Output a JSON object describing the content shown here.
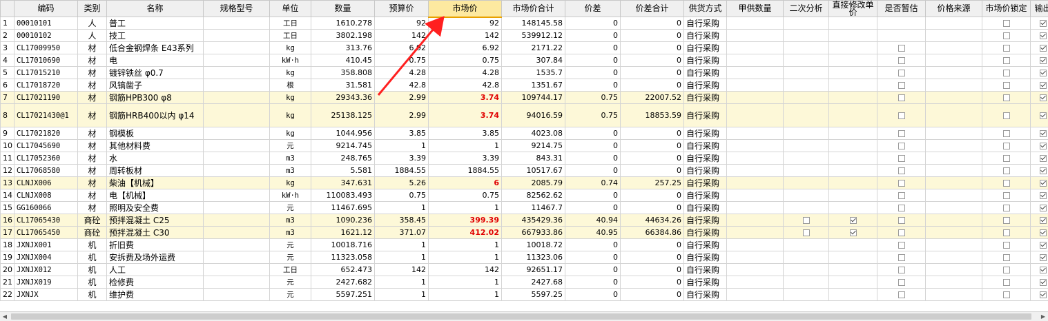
{
  "headers": [
    "编码",
    "类别",
    "名称",
    "规格型号",
    "单位",
    "数量",
    "预算价",
    "市场价",
    "市场价合计",
    "价差",
    "价差合计",
    "供货方式",
    "甲供数量",
    "二次分析",
    "直接修改单价",
    "是否暂估",
    "价格来源",
    "市场价锁定",
    "输出"
  ],
  "rows": [
    {
      "idx": "1",
      "code": "00010101",
      "cat": "人",
      "name": "普工",
      "spec": "",
      "unit": "工日",
      "qty": "1610.278",
      "budget": "92",
      "market": "92",
      "market_total": "148145.58",
      "diff": "0",
      "diff_total": "0",
      "supply": "自行采购",
      "jia_qty": "",
      "second": null,
      "direct": null,
      "est": null,
      "source": "",
      "lock": false,
      "output": true,
      "hl": false,
      "red": false,
      "tall": false
    },
    {
      "idx": "2",
      "code": "00010102",
      "cat": "人",
      "name": "技工",
      "spec": "",
      "unit": "工日",
      "qty": "3802.198",
      "budget": "142",
      "market": "142",
      "market_total": "539912.12",
      "diff": "0",
      "diff_total": "0",
      "supply": "自行采购",
      "jia_qty": "",
      "second": null,
      "direct": null,
      "est": null,
      "source": "",
      "lock": false,
      "output": true,
      "hl": false,
      "red": false,
      "tall": false
    },
    {
      "idx": "3",
      "code": "CL17009950",
      "cat": "材",
      "name": "低合金钢焊条 E43系列",
      "spec": "",
      "unit": "kg",
      "qty": "313.76",
      "budget": "6.92",
      "market": "6.92",
      "market_total": "2171.22",
      "diff": "0",
      "diff_total": "0",
      "supply": "自行采购",
      "jia_qty": "",
      "second": null,
      "direct": null,
      "est": false,
      "source": "",
      "lock": false,
      "output": true,
      "hl": false,
      "red": false,
      "tall": false
    },
    {
      "idx": "4",
      "code": "CL17010690",
      "cat": "材",
      "name": "电",
      "spec": "",
      "unit": "kW·h",
      "qty": "410.45",
      "budget": "0.75",
      "market": "0.75",
      "market_total": "307.84",
      "diff": "0",
      "diff_total": "0",
      "supply": "自行采购",
      "jia_qty": "",
      "second": null,
      "direct": null,
      "est": false,
      "source": "",
      "lock": false,
      "output": true,
      "hl": false,
      "red": false,
      "tall": false
    },
    {
      "idx": "5",
      "code": "CL17015210",
      "cat": "材",
      "name": "镀锌铁丝 φ0.7",
      "spec": "",
      "unit": "kg",
      "qty": "358.808",
      "budget": "4.28",
      "market": "4.28",
      "market_total": "1535.7",
      "diff": "0",
      "diff_total": "0",
      "supply": "自行采购",
      "jia_qty": "",
      "second": null,
      "direct": null,
      "est": false,
      "source": "",
      "lock": false,
      "output": true,
      "hl": false,
      "red": false,
      "tall": false
    },
    {
      "idx": "6",
      "code": "CL17018720",
      "cat": "材",
      "name": "风镐凿子",
      "spec": "",
      "unit": "根",
      "qty": "31.581",
      "budget": "42.8",
      "market": "42.8",
      "market_total": "1351.67",
      "diff": "0",
      "diff_total": "0",
      "supply": "自行采购",
      "jia_qty": "",
      "second": null,
      "direct": null,
      "est": false,
      "source": "",
      "lock": false,
      "output": true,
      "hl": false,
      "red": false,
      "tall": false
    },
    {
      "idx": "7",
      "code": "CL17021190",
      "cat": "材",
      "name": "钢筋HPB300 φ8",
      "spec": "",
      "unit": "kg",
      "qty": "29343.36",
      "budget": "2.99",
      "market": "3.74",
      "market_total": "109744.17",
      "diff": "0.75",
      "diff_total": "22007.52",
      "supply": "自行采购",
      "jia_qty": "",
      "second": null,
      "direct": null,
      "est": false,
      "source": "",
      "lock": false,
      "output": true,
      "hl": true,
      "red": true,
      "tall": false
    },
    {
      "idx": "8",
      "code": "CL17021430@1",
      "cat": "材",
      "name": "钢筋HRB400以内 φ14",
      "spec": "",
      "unit": "kg",
      "qty": "25138.125",
      "budget": "2.99",
      "market": "3.74",
      "market_total": "94016.59",
      "diff": "0.75",
      "diff_total": "18853.59",
      "supply": "自行采购",
      "jia_qty": "",
      "second": null,
      "direct": null,
      "est": false,
      "source": "",
      "lock": false,
      "output": true,
      "hl": true,
      "red": true,
      "tall": true
    },
    {
      "idx": "9",
      "code": "CL17021820",
      "cat": "材",
      "name": "钢模板",
      "spec": "",
      "unit": "kg",
      "qty": "1044.956",
      "budget": "3.85",
      "market": "3.85",
      "market_total": "4023.08",
      "diff": "0",
      "diff_total": "0",
      "supply": "自行采购",
      "jia_qty": "",
      "second": null,
      "direct": null,
      "est": false,
      "source": "",
      "lock": false,
      "output": true,
      "hl": false,
      "red": false,
      "tall": false
    },
    {
      "idx": "10",
      "code": "CL17045690",
      "cat": "材",
      "name": "其他材料费",
      "spec": "",
      "unit": "元",
      "qty": "9214.745",
      "budget": "1",
      "market": "1",
      "market_total": "9214.75",
      "diff": "0",
      "diff_total": "0",
      "supply": "自行采购",
      "jia_qty": "",
      "second": null,
      "direct": null,
      "est": false,
      "source": "",
      "lock": false,
      "output": true,
      "hl": false,
      "red": false,
      "tall": false
    },
    {
      "idx": "11",
      "code": "CL17052360",
      "cat": "材",
      "name": "水",
      "spec": "",
      "unit": "m3",
      "qty": "248.765",
      "budget": "3.39",
      "market": "3.39",
      "market_total": "843.31",
      "diff": "0",
      "diff_total": "0",
      "supply": "自行采购",
      "jia_qty": "",
      "second": null,
      "direct": null,
      "est": false,
      "source": "",
      "lock": false,
      "output": true,
      "hl": false,
      "red": false,
      "tall": false
    },
    {
      "idx": "12",
      "code": "CL17068580",
      "cat": "材",
      "name": "周转板材",
      "spec": "",
      "unit": "m3",
      "qty": "5.581",
      "budget": "1884.55",
      "market": "1884.55",
      "market_total": "10517.67",
      "diff": "0",
      "diff_total": "0",
      "supply": "自行采购",
      "jia_qty": "",
      "second": null,
      "direct": null,
      "est": false,
      "source": "",
      "lock": false,
      "output": true,
      "hl": false,
      "red": false,
      "tall": false
    },
    {
      "idx": "13",
      "code": "CLNJX006",
      "cat": "材",
      "name": "柴油【机械】",
      "spec": "",
      "unit": "kg",
      "qty": "347.631",
      "budget": "5.26",
      "market": "6",
      "market_total": "2085.79",
      "diff": "0.74",
      "diff_total": "257.25",
      "supply": "自行采购",
      "jia_qty": "",
      "second": null,
      "direct": null,
      "est": false,
      "source": "",
      "lock": false,
      "output": true,
      "hl": true,
      "red": true,
      "tall": false
    },
    {
      "idx": "14",
      "code": "CLNJX008",
      "cat": "材",
      "name": "电【机械】",
      "spec": "",
      "unit": "kW·h",
      "qty": "110083.493",
      "budget": "0.75",
      "market": "0.75",
      "market_total": "82562.62",
      "diff": "0",
      "diff_total": "0",
      "supply": "自行采购",
      "jia_qty": "",
      "second": null,
      "direct": null,
      "est": false,
      "source": "",
      "lock": false,
      "output": true,
      "hl": false,
      "red": false,
      "tall": false
    },
    {
      "idx": "15",
      "code": "GG160066",
      "cat": "材",
      "name": "照明及安全费",
      "spec": "",
      "unit": "元",
      "qty": "11467.695",
      "budget": "1",
      "market": "1",
      "market_total": "11467.7",
      "diff": "0",
      "diff_total": "0",
      "supply": "自行采购",
      "jia_qty": "",
      "second": null,
      "direct": null,
      "est": false,
      "source": "",
      "lock": false,
      "output": true,
      "hl": false,
      "red": false,
      "tall": false
    },
    {
      "idx": "16",
      "code": "CL17065430",
      "cat": "商砼",
      "name": "预拌混凝土 C25",
      "spec": "",
      "unit": "m3",
      "qty": "1090.236",
      "budget": "358.45",
      "market": "399.39",
      "market_total": "435429.36",
      "diff": "40.94",
      "diff_total": "44634.26",
      "supply": "自行采购",
      "jia_qty": "",
      "second": false,
      "direct": true,
      "est": false,
      "source": "",
      "lock": false,
      "output": true,
      "hl": true,
      "red": true,
      "tall": false
    },
    {
      "idx": "17",
      "code": "CL17065450",
      "cat": "商砼",
      "name": "预拌混凝土 C30",
      "spec": "",
      "unit": "m3",
      "qty": "1621.12",
      "budget": "371.07",
      "market": "412.02",
      "market_total": "667933.86",
      "diff": "40.95",
      "diff_total": "66384.86",
      "supply": "自行采购",
      "jia_qty": "",
      "second": false,
      "direct": true,
      "est": false,
      "source": "",
      "lock": false,
      "output": true,
      "hl": true,
      "red": true,
      "tall": false
    },
    {
      "idx": "18",
      "code": "JXNJX001",
      "cat": "机",
      "name": "折旧费",
      "spec": "",
      "unit": "元",
      "qty": "10018.716",
      "budget": "1",
      "market": "1",
      "market_total": "10018.72",
      "diff": "0",
      "diff_total": "0",
      "supply": "自行采购",
      "jia_qty": "",
      "second": null,
      "direct": null,
      "est": false,
      "source": "",
      "lock": false,
      "output": true,
      "hl": false,
      "red": false,
      "tall": false
    },
    {
      "idx": "19",
      "code": "JXNJX004",
      "cat": "机",
      "name": "安拆费及场外运费",
      "spec": "",
      "unit": "元",
      "qty": "11323.058",
      "budget": "1",
      "market": "1",
      "market_total": "11323.06",
      "diff": "0",
      "diff_total": "0",
      "supply": "自行采购",
      "jia_qty": "",
      "second": null,
      "direct": null,
      "est": false,
      "source": "",
      "lock": false,
      "output": true,
      "hl": false,
      "red": false,
      "tall": false
    },
    {
      "idx": "20",
      "code": "JXNJX012",
      "cat": "机",
      "name": "人工",
      "spec": "",
      "unit": "工日",
      "qty": "652.473",
      "budget": "142",
      "market": "142",
      "market_total": "92651.17",
      "diff": "0",
      "diff_total": "0",
      "supply": "自行采购",
      "jia_qty": "",
      "second": null,
      "direct": null,
      "est": false,
      "source": "",
      "lock": false,
      "output": true,
      "hl": false,
      "red": false,
      "tall": false
    },
    {
      "idx": "21",
      "code": "JXNJX019",
      "cat": "机",
      "name": "检修费",
      "spec": "",
      "unit": "元",
      "qty": "2427.682",
      "budget": "1",
      "market": "1",
      "market_total": "2427.68",
      "diff": "0",
      "diff_total": "0",
      "supply": "自行采购",
      "jia_qty": "",
      "second": null,
      "direct": null,
      "est": false,
      "source": "",
      "lock": false,
      "output": true,
      "hl": false,
      "red": false,
      "tall": false
    },
    {
      "idx": "22",
      "code": "JXNJX",
      "cat": "机",
      "name": "维护费",
      "spec": "",
      "unit": "元",
      "qty": "5597.251",
      "budget": "1",
      "market": "1",
      "market_total": "5597.25",
      "diff": "0",
      "diff_total": "0",
      "supply": "自行采购",
      "jia_qty": "",
      "second": null,
      "direct": null,
      "est": false,
      "source": "",
      "lock": false,
      "output": true,
      "hl": false,
      "red": false,
      "tall": false
    }
  ],
  "colors": {
    "active_header": "#fde9a0",
    "highlight_row": "#fdf8d8",
    "red_value": "#e00000",
    "annotation_arrow": "#ff2020"
  },
  "annotation_icon": "red-arrow-icon"
}
